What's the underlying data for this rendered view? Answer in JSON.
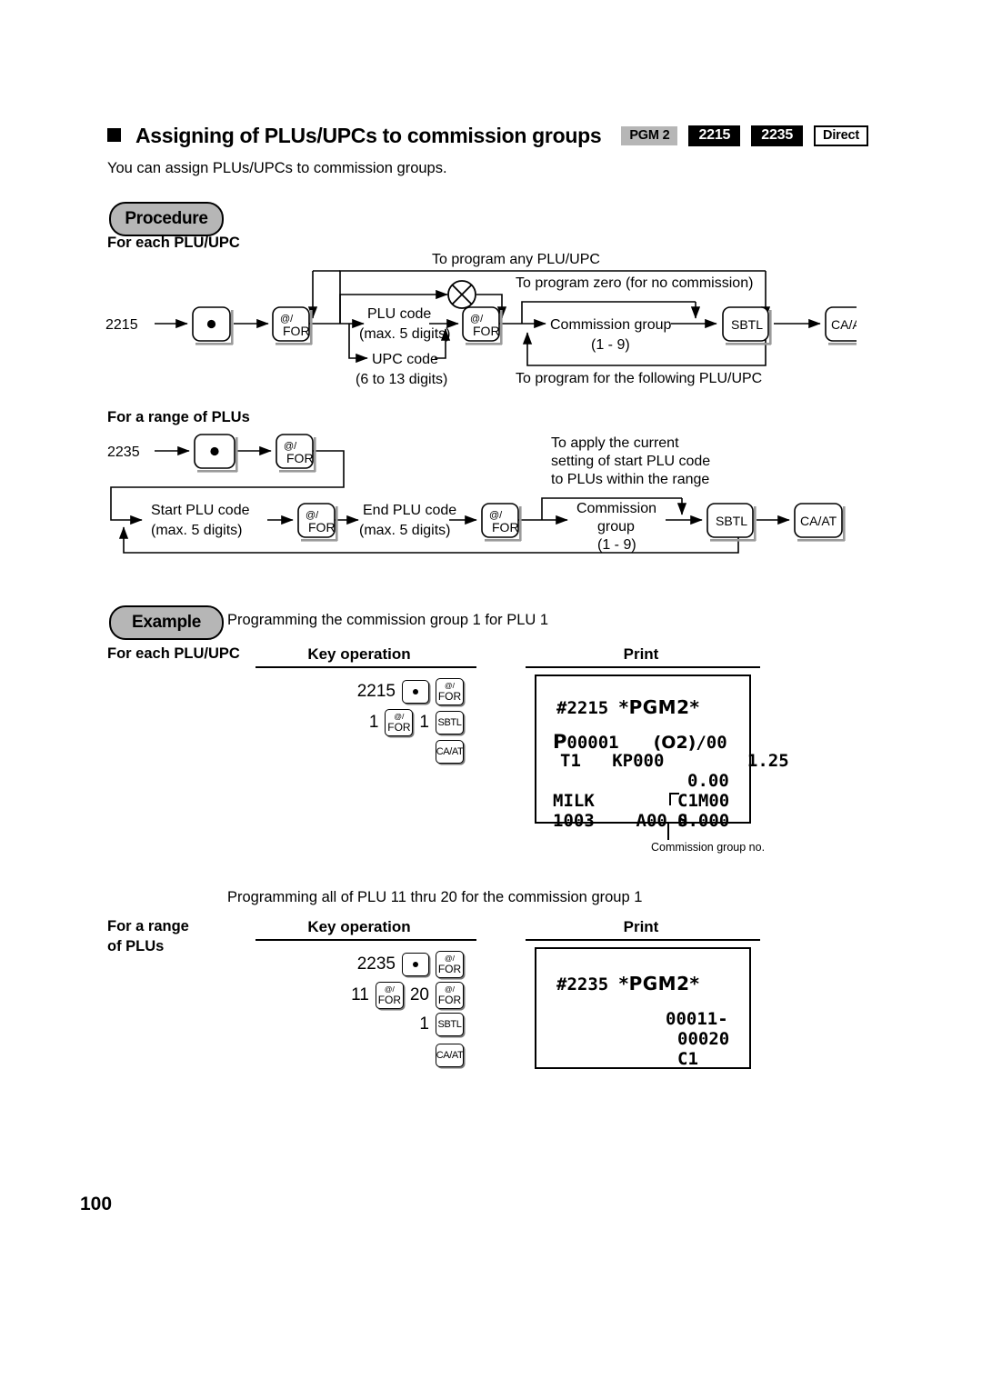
{
  "header": {
    "title": "Assigning of PLUs/UPCs to commission groups",
    "badges": [
      {
        "label": "PGM 2",
        "style": "gray"
      },
      {
        "label": "2215",
        "style": "black"
      },
      {
        "label": "2235",
        "style": "black"
      },
      {
        "label": "Direct",
        "style": "outline"
      }
    ],
    "intro": "You can assign PLUs/UPCs to commission groups."
  },
  "procedure": {
    "pill_label": "Procedure",
    "for_each_label": "For each PLU/UPC",
    "for_range_label": "For a range of PLUs",
    "flow_each": {
      "start_code": "2215",
      "keys": {
        "dot": "●",
        "at_for_l1": "@/",
        "at_for_l2": "FOR",
        "sbtl": "SBTL",
        "caat": "CA/AT"
      },
      "nodes": {
        "plu_code": "PLU code",
        "plu_code_sub": "(max. 5 digits)",
        "upc_code": "UPC code",
        "upc_code_sub": "(6 to 13 digits)",
        "commission_group": "Commission group",
        "commission_group_sub": "(1 - 9)"
      },
      "annotations": {
        "any": "To program any PLU/UPC",
        "zero": "To program zero (for no commission)",
        "following": "To program for the following PLU/UPC"
      }
    },
    "flow_range": {
      "start_code": "2235",
      "nodes": {
        "start_plu": "Start PLU code",
        "start_plu_sub": "(max. 5 digits)",
        "end_plu": "End PLU code",
        "end_plu_sub": "(max. 5 digits)",
        "commission": "Commission",
        "commission_2": "group",
        "commission_sub": "(1 - 9)"
      },
      "annotations": {
        "apply_1": "To apply the current",
        "apply_2": "setting of start PLU code",
        "apply_3": "to PLUs within the range"
      }
    }
  },
  "example": {
    "pill_label": "Example",
    "desc_1": "Programming the commission group 1 for PLU 1",
    "desc_2": "Programming all of PLU 11 thru 20 for the commission group 1",
    "col_key_operation": "Key operation",
    "col_print": "Print",
    "block_1": {
      "row_label": "For each PLU/UPC",
      "keys": {
        "row1": {
          "num": "2215",
          "chips": [
            "dot",
            "at_for"
          ]
        },
        "row2": {
          "num1": "1",
          "chip1": "at_for",
          "num2": "1",
          "chip2": "sbtl"
        },
        "row3": {
          "chip": "caat"
        }
      },
      "print": {
        "l1_a": "#2215 ",
        "l1_b": "*PGM2*",
        "l2_a": "P",
        "l2_b": "00001",
        "l2_c": "(O2)",
        "l2_d": "/00",
        "l3": "T1   KP000        1.25",
        "l4": "0.00",
        "l5_a": "MILK",
        "l5_b": "C1M00",
        "l6_a": "1003    A00 S",
        "l6_b": "0.000"
      },
      "caption": "Commission group no."
    },
    "block_2": {
      "row_label_1": "For a range",
      "row_label_2": "of PLUs",
      "keys": {
        "row1": {
          "num": "2235",
          "chips": [
            "dot",
            "at_for"
          ]
        },
        "row2": {
          "num1": "11",
          "chip1": "at_for",
          "num2": "20",
          "chip2": "at_for"
        },
        "row3": {
          "num": "1",
          "chip": "sbtl"
        },
        "row4": {
          "chip": "caat"
        }
      },
      "print": {
        "l1_a": "#2235 ",
        "l1_b": "*PGM2*",
        "l2": "00011-",
        "l3": "00020",
        "l4": "C1"
      }
    }
  },
  "footer": {
    "page_number": "100"
  }
}
